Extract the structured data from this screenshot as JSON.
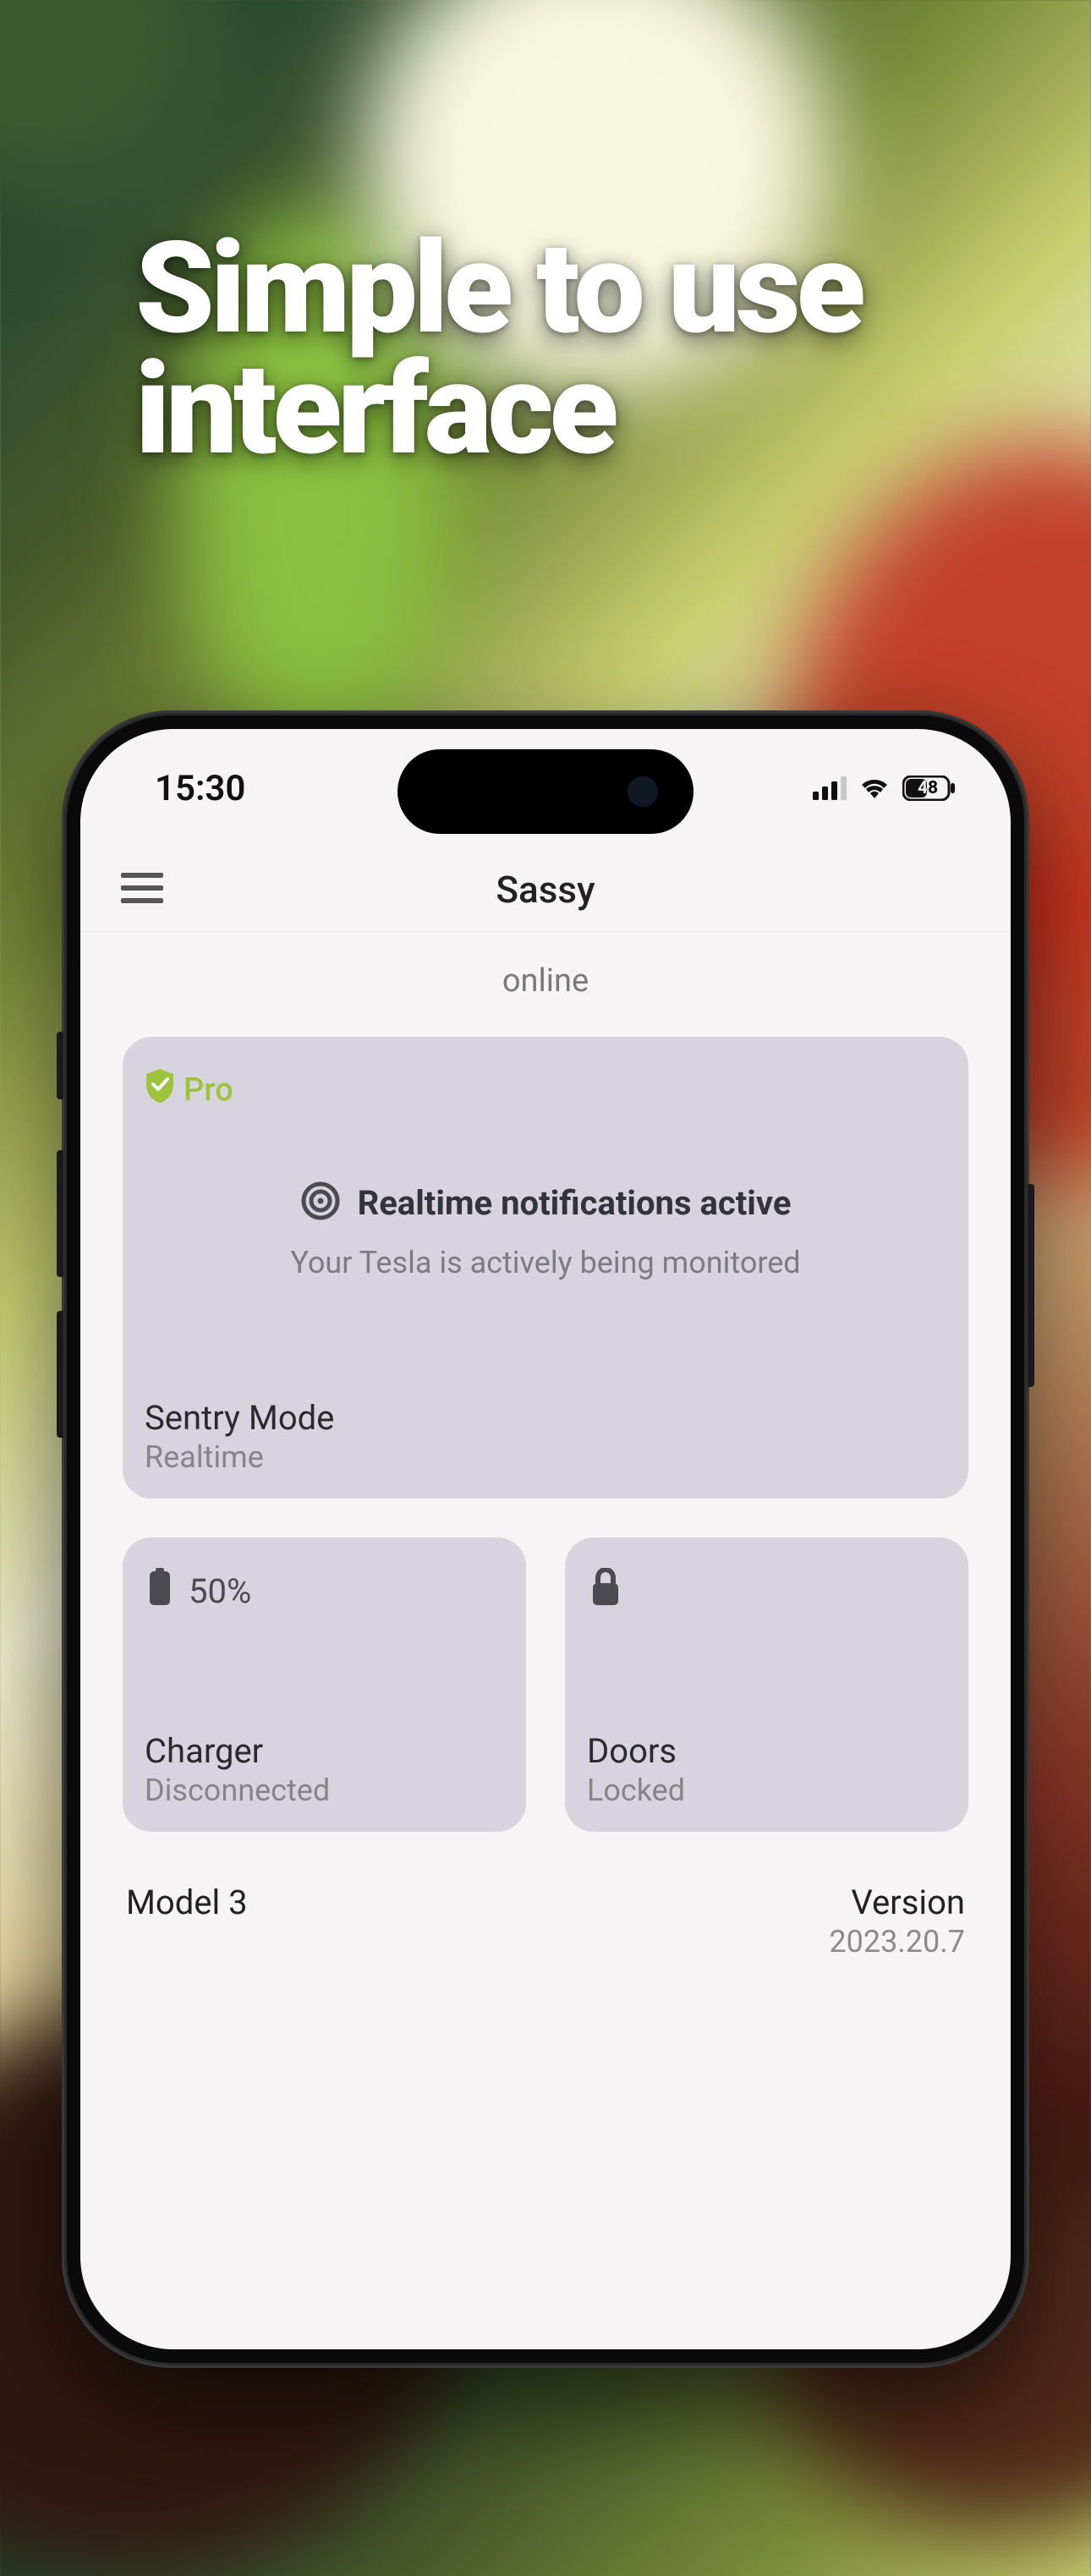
{
  "marketing": {
    "headline": "Simple to use interface"
  },
  "status_bar": {
    "time": "15:30",
    "battery": "48"
  },
  "nav": {
    "title": "Sassy"
  },
  "connection": {
    "status": "online"
  },
  "sentry_card": {
    "badge": "Pro",
    "title": "Realtime notifications active",
    "subtitle": "Your Tesla is actively being monitored",
    "label": "Sentry Mode",
    "mode": "Realtime"
  },
  "charger_card": {
    "battery_pct": "50%",
    "label": "Charger",
    "status": "Disconnected"
  },
  "doors_card": {
    "label": "Doors",
    "status": "Locked"
  },
  "vehicle": {
    "model": "Model 3",
    "version_label": "Version",
    "version": "2023.20.7"
  },
  "colors": {
    "accent_green": "#9cc43a",
    "card_bg": "#d7d4df",
    "app_bg": "#f6f4f5"
  }
}
